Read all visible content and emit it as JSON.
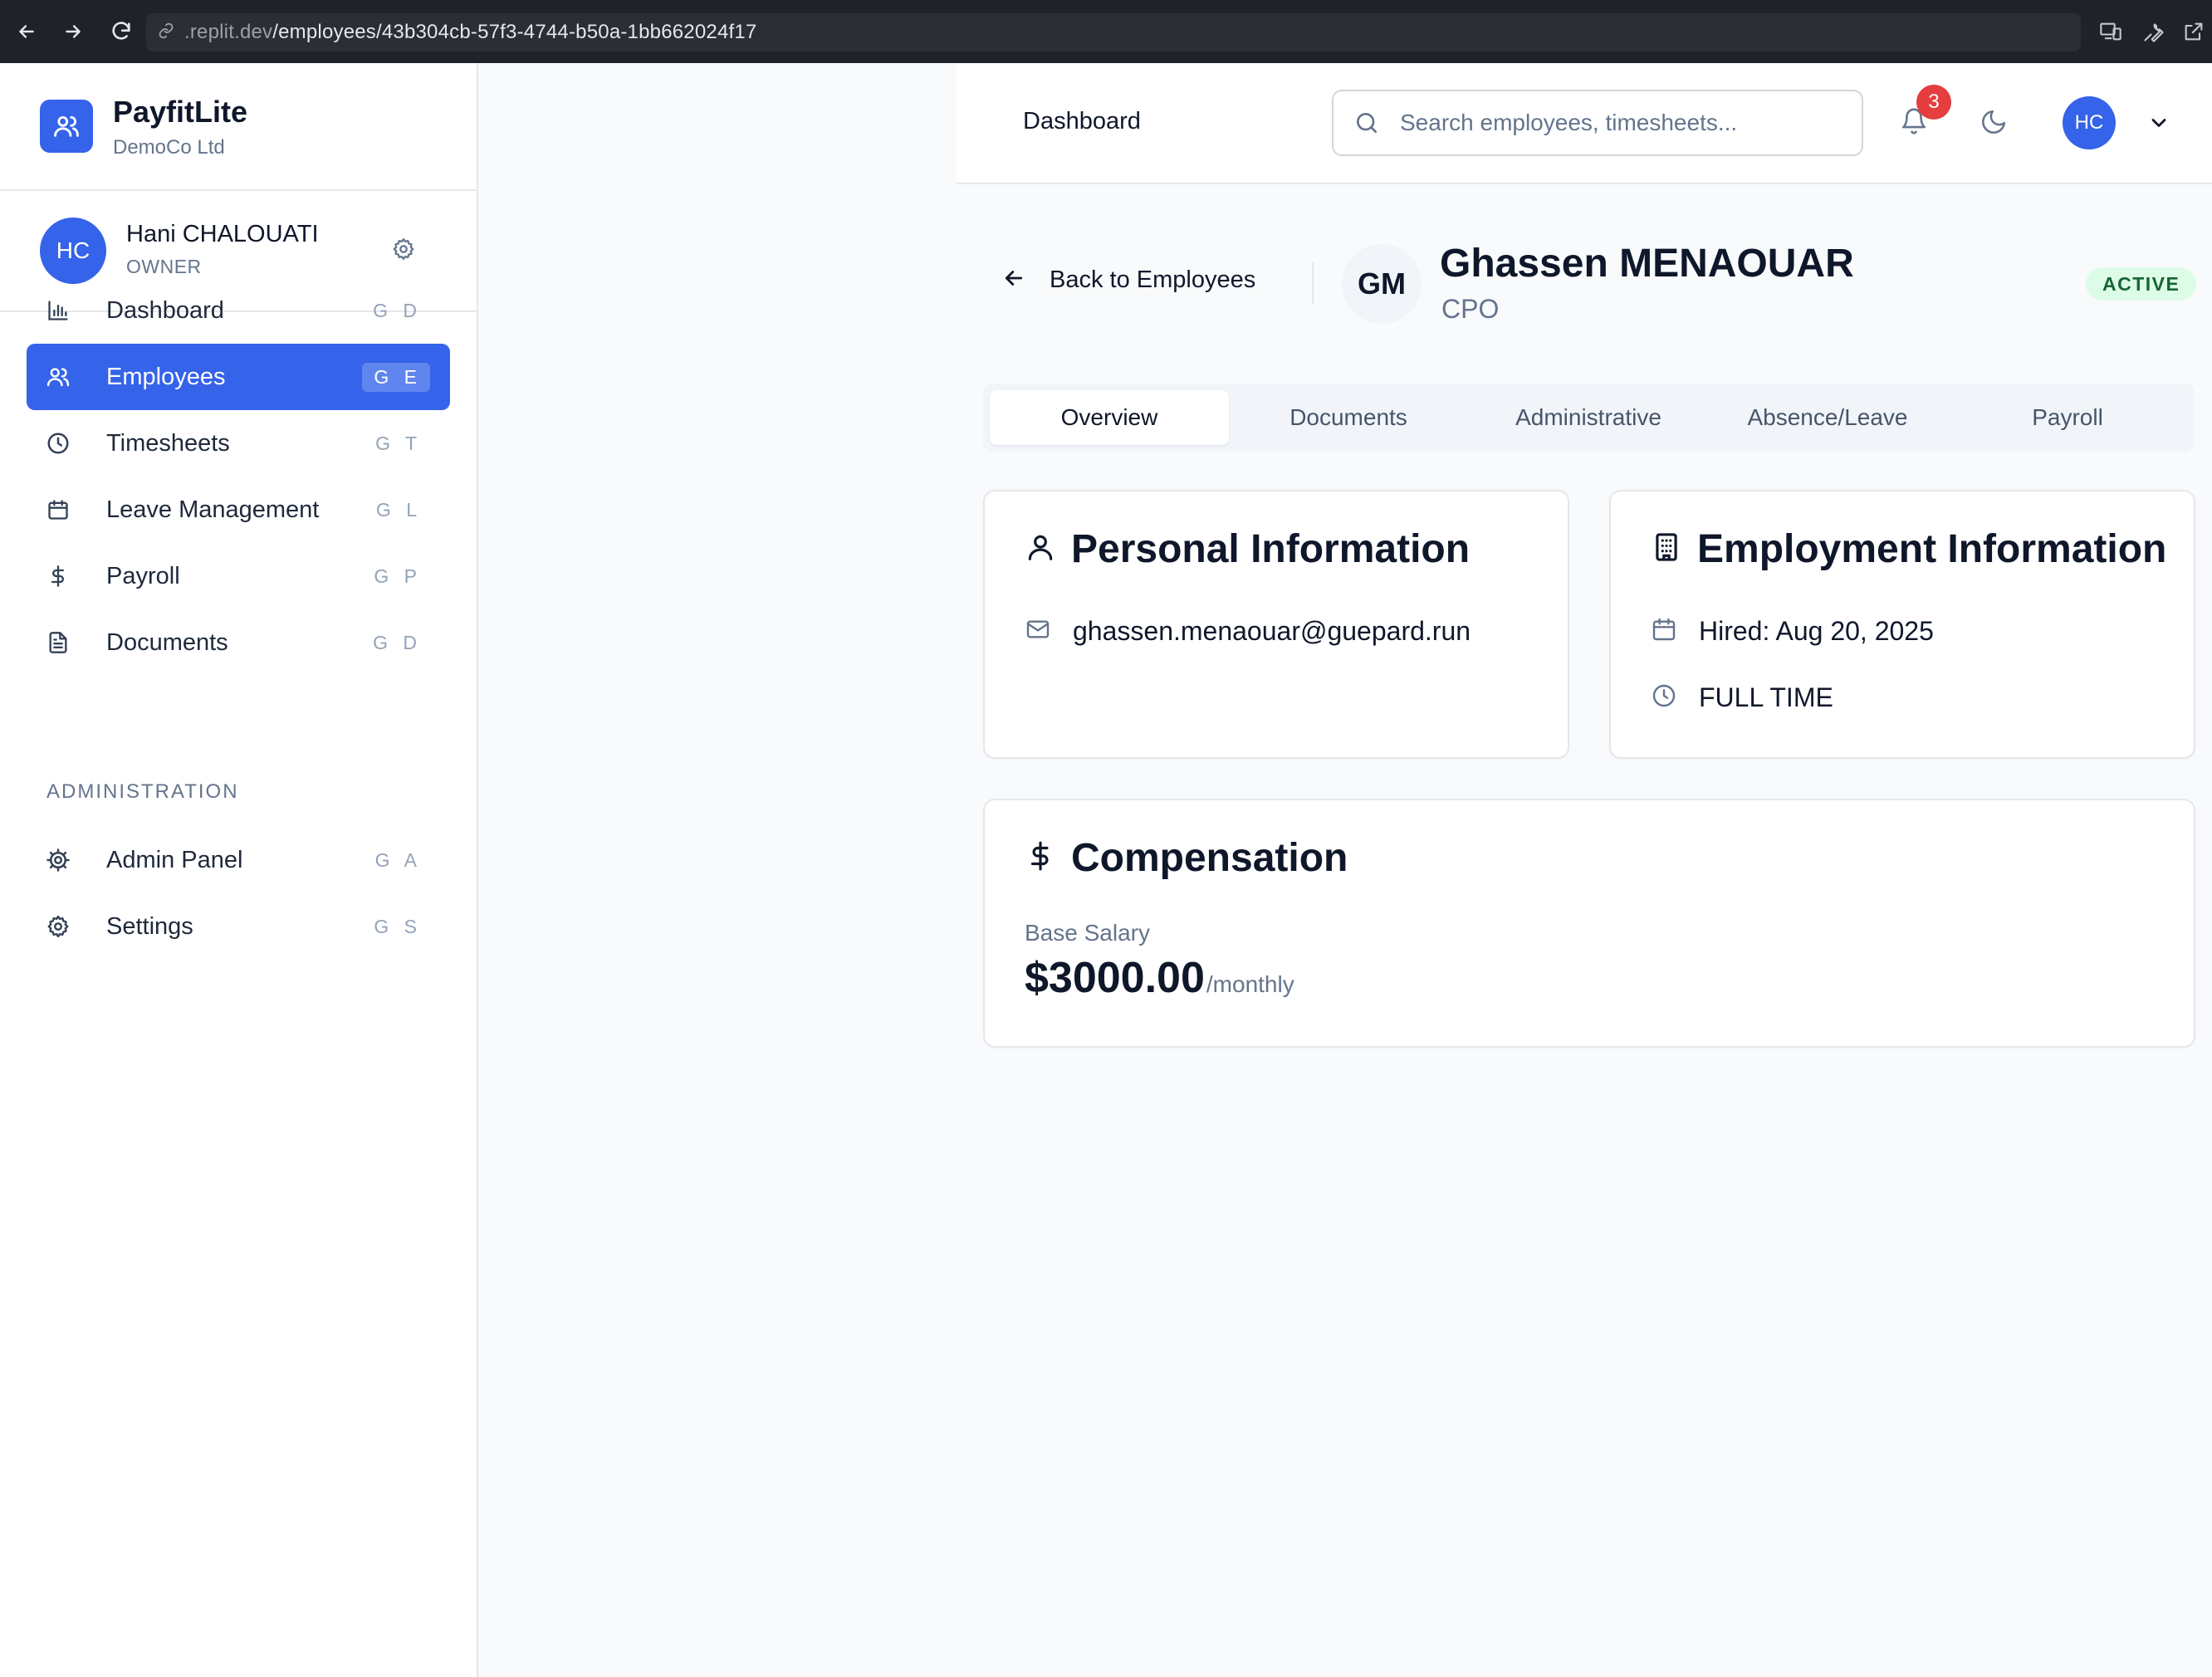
{
  "browser": {
    "url_prefix": ".replit.dev",
    "url_path": "/employees/43b304cb-57f3-4744-b50a-1bb662024f17"
  },
  "brand": {
    "name": "PayfitLite",
    "company": "DemoCo Ltd",
    "accent": "#3563e9"
  },
  "user": {
    "initials": "HC",
    "name": "Hani CHALOUATI",
    "role": "OWNER"
  },
  "nav": {
    "items": [
      {
        "label": "Dashboard",
        "shortcut": "G D",
        "icon": "bar-chart-icon"
      },
      {
        "label": "Employees",
        "shortcut": "G E",
        "icon": "users-icon",
        "active": true
      },
      {
        "label": "Timesheets",
        "shortcut": "G T",
        "icon": "clock-icon"
      },
      {
        "label": "Leave Management",
        "shortcut": "G L",
        "icon": "calendar-icon"
      },
      {
        "label": "Payroll",
        "shortcut": "G P",
        "icon": "dollar-icon"
      },
      {
        "label": "Documents",
        "shortcut": "G D",
        "icon": "file-icon"
      }
    ],
    "section_title": "ADMINISTRATION",
    "admin_items": [
      {
        "label": "Admin Panel",
        "shortcut": "G A",
        "icon": "cog-icon"
      },
      {
        "label": "Settings",
        "shortcut": "G S",
        "icon": "gear-icon"
      }
    ]
  },
  "header": {
    "breadcrumb": "Dashboard",
    "search_placeholder": "Search employees, timesheets...",
    "notification_count": "3",
    "user_initials": "HC"
  },
  "employee": {
    "back_label": "Back to Employees",
    "initials": "GM",
    "name": "Ghassen MENAOUAR",
    "title": "CPO",
    "status": "ACTIVE"
  },
  "tabs": [
    {
      "label": "Overview",
      "active": true
    },
    {
      "label": "Documents"
    },
    {
      "label": "Administrative"
    },
    {
      "label": "Absence/Leave"
    },
    {
      "label": "Payroll"
    }
  ],
  "personal": {
    "title": "Personal Information",
    "email": "ghassen.menaouar@guepard.run"
  },
  "employment": {
    "title": "Employment Information",
    "hired": "Hired: Aug 20, 2025",
    "type": "FULL TIME"
  },
  "compensation": {
    "title": "Compensation",
    "label": "Base Salary",
    "amount": "$3000.00",
    "period": "/monthly"
  }
}
